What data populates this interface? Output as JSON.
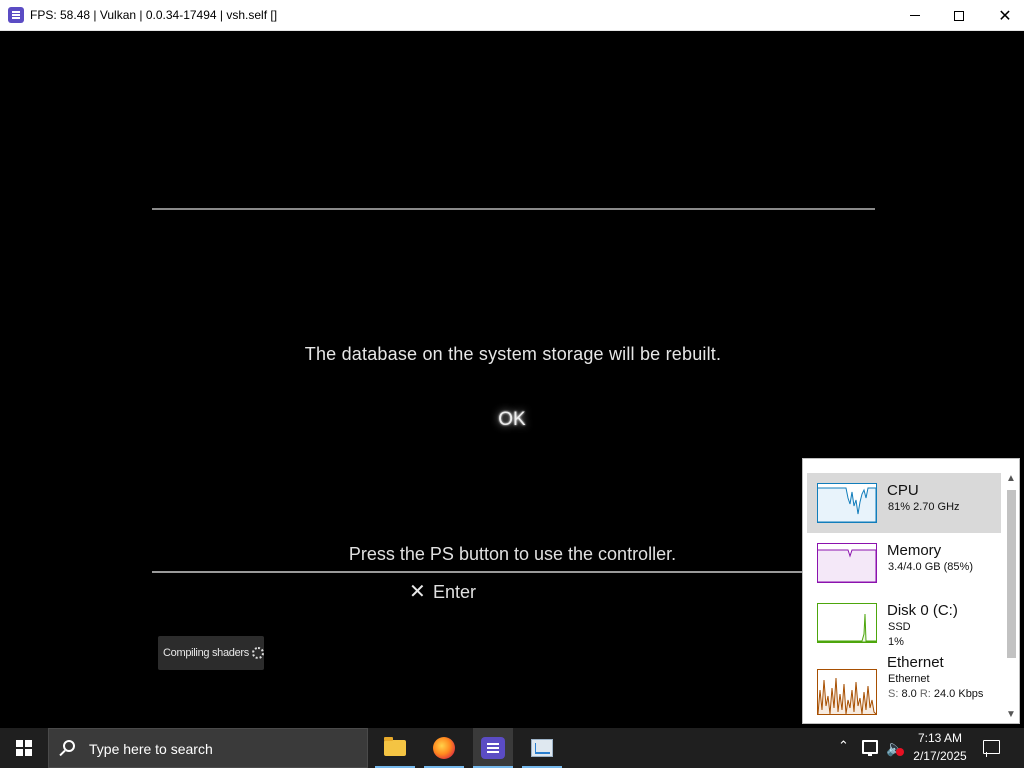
{
  "window": {
    "title": "FPS: 58.48 | Vulkan | 0.0.34-17494 | vsh.self []",
    "app_icon": "rpcs3-icon",
    "controls": {
      "minimize": "minimize-icon",
      "maximize": "maximize-icon",
      "close": "✕"
    }
  },
  "game": {
    "message": "The database on the system storage will be rebuilt.",
    "ok_label": "OK",
    "press_text": "Press the PS button to use the controller.",
    "enter_glyph": "✕",
    "enter_label": "Enter",
    "shader_toast": "Compiling shaders"
  },
  "perf_panel": {
    "items": [
      {
        "name": "CPU",
        "line1": "81% 2.70 GHz",
        "selected": true,
        "color": "#117dbb"
      },
      {
        "name": "Memory",
        "line1": "3.4/4.0 GB (85%)",
        "selected": false,
        "color": "#8b12ae"
      },
      {
        "name": "Disk 0 (C:)",
        "line1": "SSD",
        "line2": "1%",
        "selected": false,
        "color": "#4da60c"
      },
      {
        "name": "Ethernet",
        "line1": "Ethernet",
        "send_label": "S:",
        "send_value": "8.0",
        "recv_label": "R:",
        "recv_value": "24.0 Kbps",
        "selected": false,
        "color": "#a74f01"
      }
    ]
  },
  "taskbar": {
    "search_placeholder": "Type here to search",
    "apps": [
      "file-explorer",
      "firefox",
      "rpcs3",
      "task-manager"
    ],
    "active_app": "rpcs3",
    "clock_time": "7:13 AM",
    "clock_date": "2/17/2025"
  }
}
